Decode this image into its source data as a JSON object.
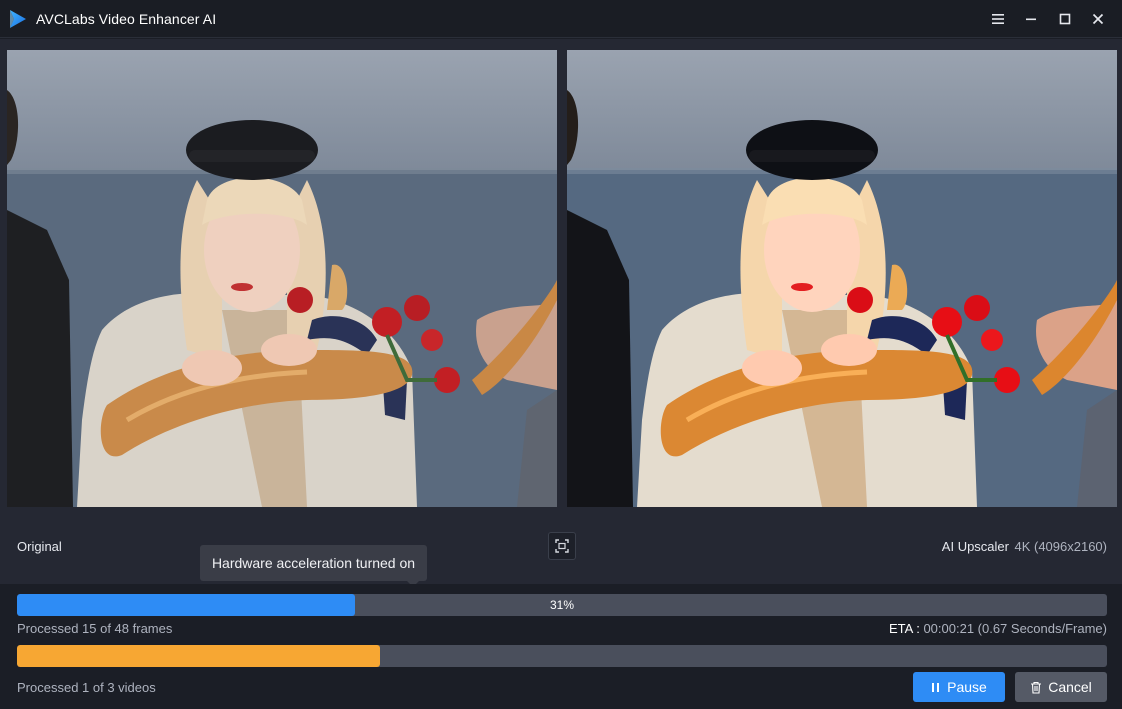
{
  "window": {
    "title": "AVCLabs Video Enhancer AI",
    "controls": [
      "menu-icon",
      "minimize-icon",
      "maximize-icon",
      "close-icon"
    ]
  },
  "preview": {
    "left_label": "Original",
    "right_model": "AI Upscaler",
    "right_resolution": "4K (4096x2160)",
    "fit_icon": "fit-screen-icon"
  },
  "tooltip": {
    "text": "Hardware acceleration turned on"
  },
  "progress": {
    "frames": {
      "percent": 31,
      "percent_label": "31%",
      "status": "Processed 15 of 48 frames",
      "eta_label": "ETA :",
      "eta_value": " 00:00:21 (0.67 Seconds/Frame)"
    },
    "videos": {
      "fraction": 0.333,
      "status": "Processed 1 of 3 videos"
    }
  },
  "actions": {
    "pause_label": "Pause",
    "cancel_label": "Cancel"
  },
  "colors": {
    "accent_blue": "#2e8cf5",
    "accent_orange": "#f7a733",
    "background": "#1b1e26"
  }
}
